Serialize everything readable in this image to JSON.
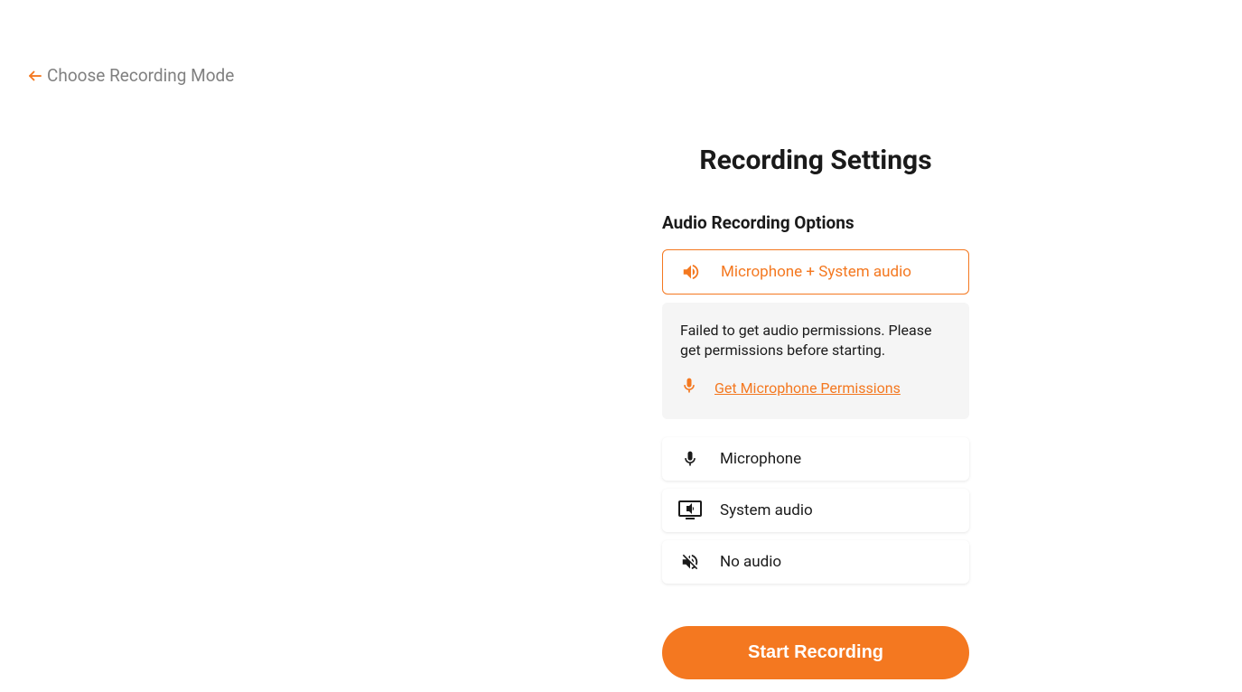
{
  "back": {
    "label": "Choose Recording Mode"
  },
  "settings": {
    "title": "Recording Settings",
    "section_header": "Audio Recording Options",
    "options": {
      "mic_system": "Microphone + System audio",
      "mic": "Microphone",
      "system": "System audio",
      "none": "No audio"
    },
    "warning": {
      "text": "Failed to get audio permissions. Please get permissions before starting.",
      "link": "Get Microphone Permissions"
    },
    "start_button": "Start Recording"
  },
  "colors": {
    "accent": "#f47820"
  }
}
